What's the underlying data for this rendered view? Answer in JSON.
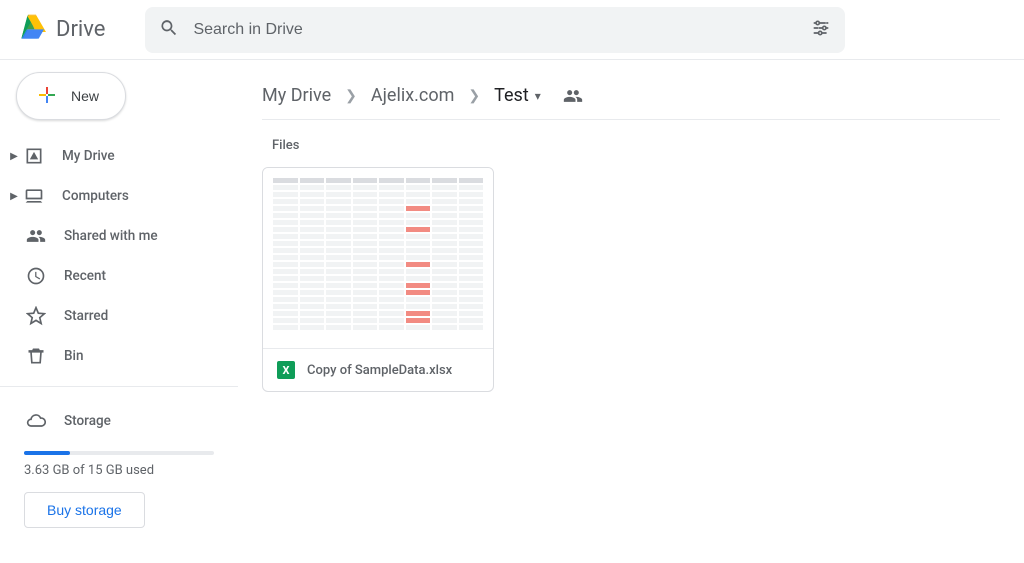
{
  "app": {
    "title": "Drive"
  },
  "search": {
    "placeholder": "Search in Drive"
  },
  "new_button": {
    "label": "New"
  },
  "nav": {
    "items": [
      {
        "key": "mydrive",
        "label": "My Drive",
        "icon": "drive-folder-icon",
        "expandable": true
      },
      {
        "key": "computers",
        "label": "Computers",
        "icon": "laptop-icon",
        "expandable": true
      },
      {
        "key": "shared",
        "label": "Shared with me",
        "icon": "people-icon",
        "expandable": false
      },
      {
        "key": "recent",
        "label": "Recent",
        "icon": "clock-icon",
        "expandable": false
      },
      {
        "key": "starred",
        "label": "Starred",
        "icon": "star-icon",
        "expandable": false
      },
      {
        "key": "bin",
        "label": "Bin",
        "icon": "trash-icon",
        "expandable": false
      }
    ],
    "storage": {
      "label": "Storage",
      "used_text": "3.63 GB of 15 GB used",
      "used_fraction": 0.242,
      "buy_label": "Buy storage"
    }
  },
  "breadcrumb": {
    "items": [
      {
        "label": "My Drive",
        "current": false
      },
      {
        "label": "Ajelix.com",
        "current": false
      },
      {
        "label": "Test",
        "current": true
      }
    ]
  },
  "files": {
    "section_label": "Files",
    "items": [
      {
        "name": "Copy of SampleData.xlsx",
        "type": "xlsx",
        "icon": "excel-icon"
      }
    ]
  }
}
